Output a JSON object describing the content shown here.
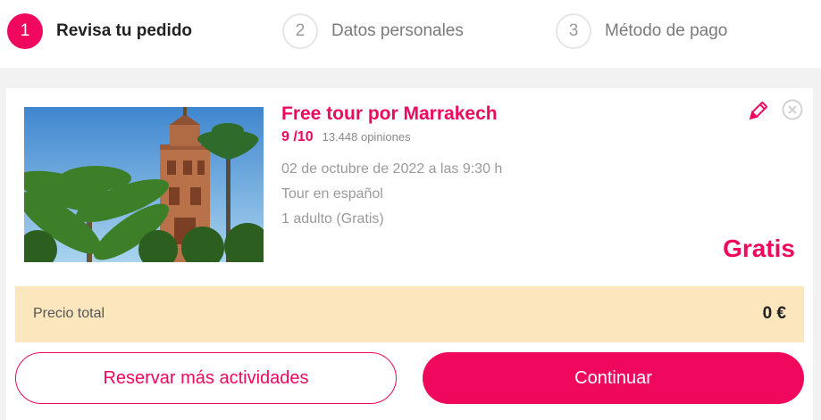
{
  "colors": {
    "accent": "#f0085f",
    "total_bg": "#fbe6bd"
  },
  "steps": [
    {
      "number": "1",
      "label": "Revisa tu pedido",
      "state": "active"
    },
    {
      "number": "2",
      "label": "Datos personales",
      "state": "inactive"
    },
    {
      "number": "3",
      "label": "Método de pago",
      "state": "inactive"
    }
  ],
  "item": {
    "title": "Free tour por Marrakech",
    "rating": "9 /10",
    "reviews": "13.448 opiniones",
    "date": "02 de octubre de 2022 a las 9:30 h",
    "language": "Tour en español",
    "people": "1 adulto (Gratis)",
    "price": "Gratis",
    "edit_icon": "pencil-icon",
    "remove_icon": "close-circle-icon"
  },
  "total": {
    "label": "Precio total",
    "value": "0 €"
  },
  "buttons": {
    "more": "Reservar más actividades",
    "continue": "Continuar"
  }
}
